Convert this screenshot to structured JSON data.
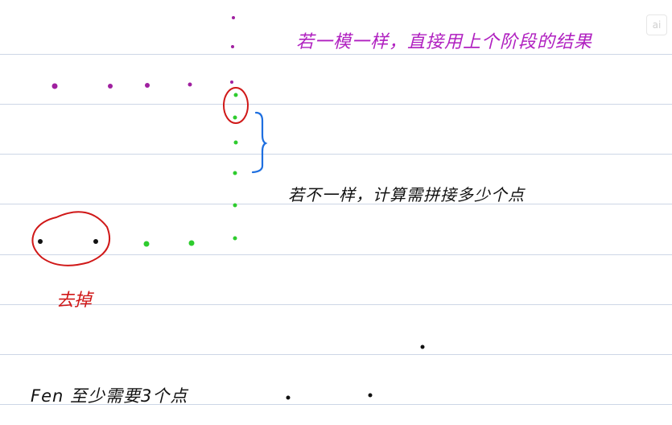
{
  "notes": {
    "top_note": "若一模一样，直接用上个阶段的结果",
    "mid_note": "若不一样，计算需拼接多少个点",
    "remove_label": "去掉",
    "bottom_note": "Fen 至少需要3个点"
  },
  "colors": {
    "top_note": "#b020c0",
    "mid_note": "#111111",
    "remove_label": "#d01818",
    "bottom_note": "#111111",
    "green_dot": "#2ecc2e",
    "purple_dot": "#a020a0",
    "black_dot": "#111111",
    "red_ink": "#d01818",
    "blue_ink": "#1e6fe0",
    "rule": "#cdd6e6"
  },
  "logo": {
    "text": "ai"
  }
}
